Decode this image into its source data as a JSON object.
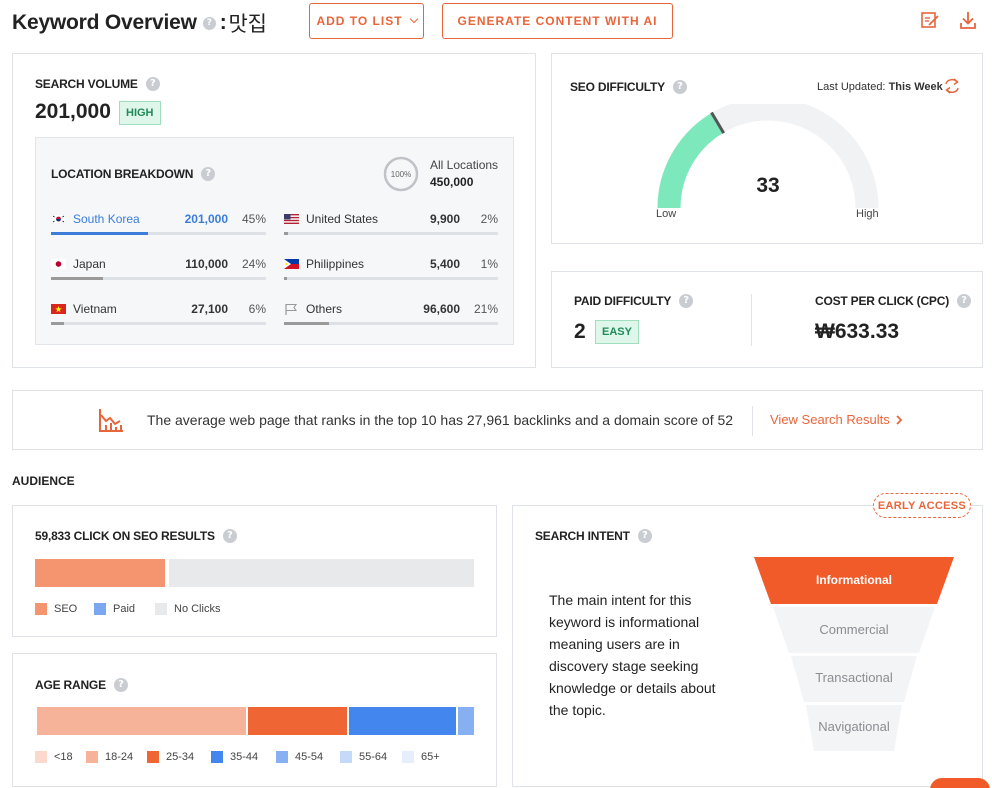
{
  "header": {
    "title": "Keyword Overview",
    "colon": ":",
    "keyword": "맛집",
    "add_to_list": "ADD TO LIST",
    "generate": "GENERATE CONTENT WITH AI"
  },
  "search_volume": {
    "label": "SEARCH VOLUME",
    "value": "201,000",
    "badge": "HIGH"
  },
  "location": {
    "title": "LOCATION BREAKDOWN",
    "ring_label": "100%",
    "all_label": "All Locations",
    "all_value": "450,000",
    "rows": [
      {
        "name": "South Korea",
        "value": "201,000",
        "pct": "45%",
        "share": 45
      },
      {
        "name": "United States",
        "value": "9,900",
        "pct": "2%",
        "share": 2
      },
      {
        "name": "Japan",
        "value": "110,000",
        "pct": "24%",
        "share": 24
      },
      {
        "name": "Philippines",
        "value": "5,400",
        "pct": "1%",
        "share": 1
      },
      {
        "name": "Vietnam",
        "value": "27,100",
        "pct": "6%",
        "share": 6
      },
      {
        "name": "Others",
        "value": "96,600",
        "pct": "21%",
        "share": 21
      }
    ]
  },
  "seo_difficulty": {
    "label": "SEO DIFFICULTY",
    "updated_prefix": "Last Updated:",
    "updated_value": "This Week",
    "value": "33",
    "score": 33,
    "low": "Low",
    "high": "High",
    "color": "#7ee8bd"
  },
  "paid_difficulty": {
    "label": "PAID DIFFICULTY",
    "value": "2",
    "badge": "EASY"
  },
  "cpc": {
    "label": "COST PER CLICK (CPC)",
    "value": "₩633.33"
  },
  "backlinks": {
    "text": "The average web page that ranks in the top 10 has 27,961 backlinks and a domain score of 52",
    "link": "View Search Results"
  },
  "audience": {
    "title": "AUDIENCE",
    "clicks": {
      "label": "59,833 CLICK ON SEO RESULTS",
      "segments": [
        {
          "name": "SEO",
          "share": 29.5,
          "color": "#f4956f"
        },
        {
          "name": "Paid",
          "share": 0.5,
          "color": "#7aa7f0"
        },
        {
          "name": "No Clicks",
          "share": 70,
          "color": "#e7e9eb"
        }
      ]
    },
    "age": {
      "label": "AGE RANGE",
      "segments": [
        {
          "name": "<18",
          "share": 0,
          "color": "#fbd9cc"
        },
        {
          "name": "18-24",
          "share": 48,
          "color": "#f7b29a"
        },
        {
          "name": "25-34",
          "share": 23,
          "color": "#ef6533"
        },
        {
          "name": "35-44",
          "share": 25,
          "color": "#4387ee"
        },
        {
          "name": "45-54",
          "share": 4,
          "color": "#86b0f2"
        },
        {
          "name": "55-64",
          "share": 0,
          "color": "#c5d9f8"
        },
        {
          "name": "65+",
          "share": 0,
          "color": "#e6eefb"
        }
      ]
    }
  },
  "intent": {
    "label": "SEARCH INTENT",
    "early_access": "EARLY ACCESS",
    "description": "The main intent for this keyword is informational meaning users are in discovery stage seeking knowledge or details about the topic.",
    "levels": [
      {
        "name": "Informational",
        "active": true
      },
      {
        "name": "Commercial",
        "active": false
      },
      {
        "name": "Transactional",
        "active": false
      },
      {
        "name": "Navigational",
        "active": false
      }
    ]
  }
}
